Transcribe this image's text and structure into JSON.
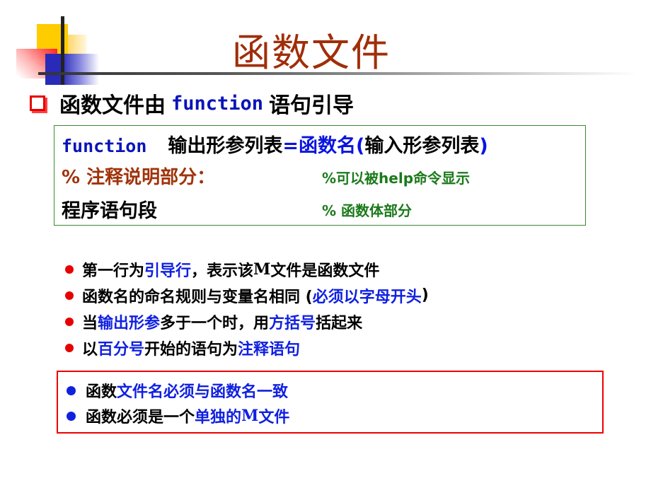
{
  "slide": {
    "title": "函数文件",
    "subtitle": {
      "prefix": "函数文件由",
      "keyword": "function",
      "suffix": "语句引导"
    },
    "code_box": {
      "line1": {
        "keyword": "function",
        "output_args": "输出形参列表",
        "equals": "=",
        "func_name": "函数名",
        "open_paren": "(",
        "input_args": "输入形参列表",
        "close_paren": ")"
      },
      "line2": {
        "text": "% 注释说明部分：",
        "comment": "%可以被help命令显示"
      },
      "line3": {
        "text": "程序语句段",
        "comment": "% 函数体部分"
      }
    },
    "bullets": [
      {
        "parts": [
          "第一行为",
          "引导行",
          "，表示该 ",
          "M",
          "文件是函数文件"
        ]
      },
      {
        "parts": [
          "函数名的命名规则与变量名相同 ( ",
          "必须以字母开头",
          " )"
        ]
      },
      {
        "parts": [
          "当",
          "输出形参",
          "多于一个时，用",
          "方括号",
          "括起来"
        ]
      },
      {
        "parts": [
          "以",
          "百分号",
          "开始的语句为",
          "注释语句"
        ]
      }
    ],
    "note_box": [
      {
        "parts": [
          "函数",
          "文件名必须与函数名一致"
        ]
      },
      {
        "parts": [
          "函数必须是一个",
          "单独的 ",
          "M",
          "文件"
        ]
      }
    ],
    "colors": {
      "title": "#a02e08",
      "keyword": "#0a14b8",
      "highlight": "#1020e0",
      "comment": "#1a7a1a",
      "code_box_border": "#3a8a30",
      "note_box_border": "#ee0000",
      "bullet_red": "#e60000",
      "bullet_blue": "#1020e0"
    }
  }
}
